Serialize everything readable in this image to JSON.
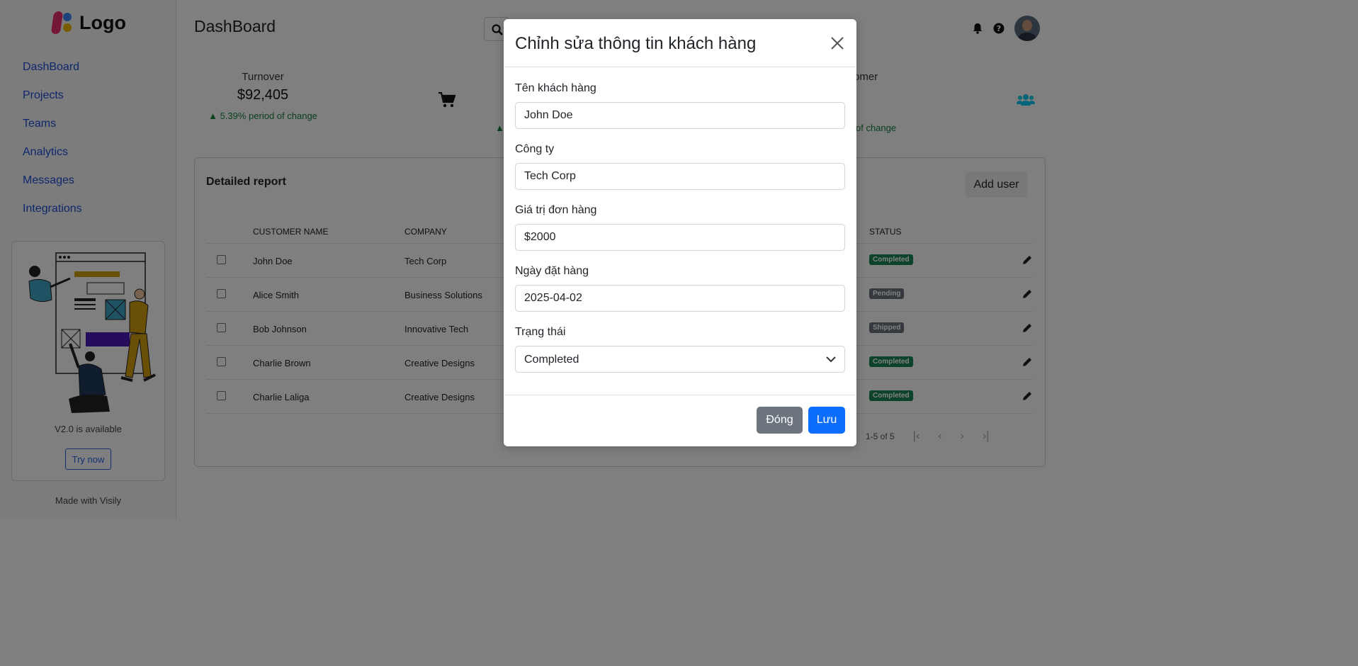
{
  "app": {
    "logo_text": "Logo",
    "page_title": "DashBoard",
    "nav": [
      "DashBoard",
      "Projects",
      "Teams",
      "Analytics",
      "Messages",
      "Integrations"
    ],
    "promo_text": "V2.0 is available",
    "promo_button": "Try now",
    "made_with": "Made with Visily"
  },
  "stats": {
    "turnover_label": "Turnover",
    "turnover_value": "$92,405",
    "turnover_change": "▲ 5.39% period of change",
    "customer_label_fragment": "omer",
    "customer_change_fragment": "of change",
    "left_arrow_fragment": "▲"
  },
  "report": {
    "title": "Detailed report",
    "add_user": "Add user",
    "columns": {
      "name": "CUSTOMER NAME",
      "company": "COMPANY",
      "status": "STATUS"
    },
    "rows": [
      {
        "name": "John Doe",
        "company": "Tech Corp",
        "status": "Completed",
        "status_color": "#198754"
      },
      {
        "name": "Alice Smith",
        "company": "Business Solutions",
        "status": "Pending",
        "status_color": "#6c757d"
      },
      {
        "name": "Bob Johnson",
        "company": "Innovative Tech",
        "status": "Shipped",
        "status_color": "#6c757d"
      },
      {
        "name": "Charlie Brown",
        "company": "Creative Designs",
        "status": "Completed",
        "status_color": "#198754"
      },
      {
        "name": "Charlie Laliga",
        "company": "Creative Designs",
        "status": "Completed",
        "status_color": "#198754"
      }
    ],
    "pagination": "1-5 of 5"
  },
  "modal": {
    "title": "Chỉnh sửa thông tin khách hàng",
    "fields": {
      "customer_label": "Tên khách hàng",
      "customer_value": "John Doe",
      "company_label": "Công ty",
      "company_value": "Tech Corp",
      "order_value_label": "Giá trị đơn hàng",
      "order_value": "$2000",
      "order_date_label": "Ngày đặt hàng",
      "order_date": "2025-04-02",
      "status_label": "Trạng thái",
      "status_value": "Completed"
    },
    "close_button": "Đóng",
    "save_button": "Lưu"
  },
  "colors": {
    "primary": "#0d6efd",
    "secondary": "#6c757d",
    "success": "#198754",
    "link": "#1d4ed8",
    "users_icon": "#0dcaf0"
  },
  "icons": [
    "search-icon",
    "cart-icon",
    "users-icon",
    "bell-icon",
    "help-icon",
    "edit-icon",
    "close-icon",
    "chevron-down-icon"
  ]
}
